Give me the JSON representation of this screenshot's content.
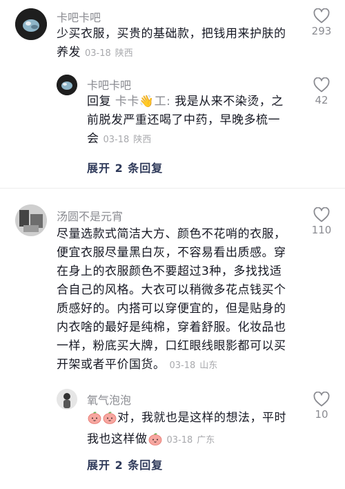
{
  "comments": [
    {
      "username": "卡吧卡吧",
      "text": "少买衣服，买贵的基础款，把钱用来护肤的养发",
      "line1": "少买衣服，买贵的基础款，把钱用来护肤的",
      "line2": "养发",
      "date": "03-18",
      "location": "陕西",
      "likes": "293",
      "reply": {
        "username": "卡吧卡吧",
        "prefix": "回复",
        "mention": "卡卡👋工:",
        "mention_name": "卡卡",
        "mention_tail": "工:",
        "text": "我是从来不染烫，之前脱发严重还喝了中药，早晚多梳一会",
        "line1_text": "我是从来不染烫，之",
        "line2": "前脱发严重还喝了中药，早晚多梳一",
        "line3": "会",
        "date": "03-18",
        "location": "陕西",
        "likes": "42"
      },
      "expand_label": "展开 2 条回复"
    },
    {
      "username": "汤圆不是元宵",
      "text": "尽量选款式简洁大方、颜色不花哨的衣服，便宜衣服尽量黑白灰，不容易看出质感。穿在身上的衣服颜色不要超过3种，多找找适合自己的风格。大衣可以稍微多花点钱买个质感好的。内搭可以穿便宜的，但是贴身的内衣啥的最好是纯棉，穿着舒服。化妆品也一样，粉底买大牌，口红眼线眼影都可以买开架或者平价国货。",
      "lines": [
        "尽量选款式简洁大方、颜色不花哨的衣服，",
        "便宜衣服尽量黑白灰，不容易看出质感。穿",
        "在身上的衣服颜色不要超过3种，多找找适",
        "合自己的风格。大衣可以稍微多花点钱买个",
        "质感好的。内搭可以穿便宜的，但是贴身的",
        "内衣啥的最好是纯棉，穿着舒服。化妆品也",
        "一样，粉底买大牌，口红眼线眼影都可以买",
        "开架或者平价国货。"
      ],
      "date": "03-18",
      "location": "山东",
      "likes": "110",
      "reply": {
        "username": "氧气泡泡",
        "line1": "对，我就也是这样的想法，平时",
        "line2": "我也这样做",
        "date": "03-18",
        "location": "广东",
        "likes": "10"
      },
      "expand_label": "展开 2 条回复"
    }
  ],
  "colors": {
    "text": "#161823",
    "username": "#8a8b91",
    "meta": "#a8a9ad",
    "expand": "#2f3a5a"
  }
}
